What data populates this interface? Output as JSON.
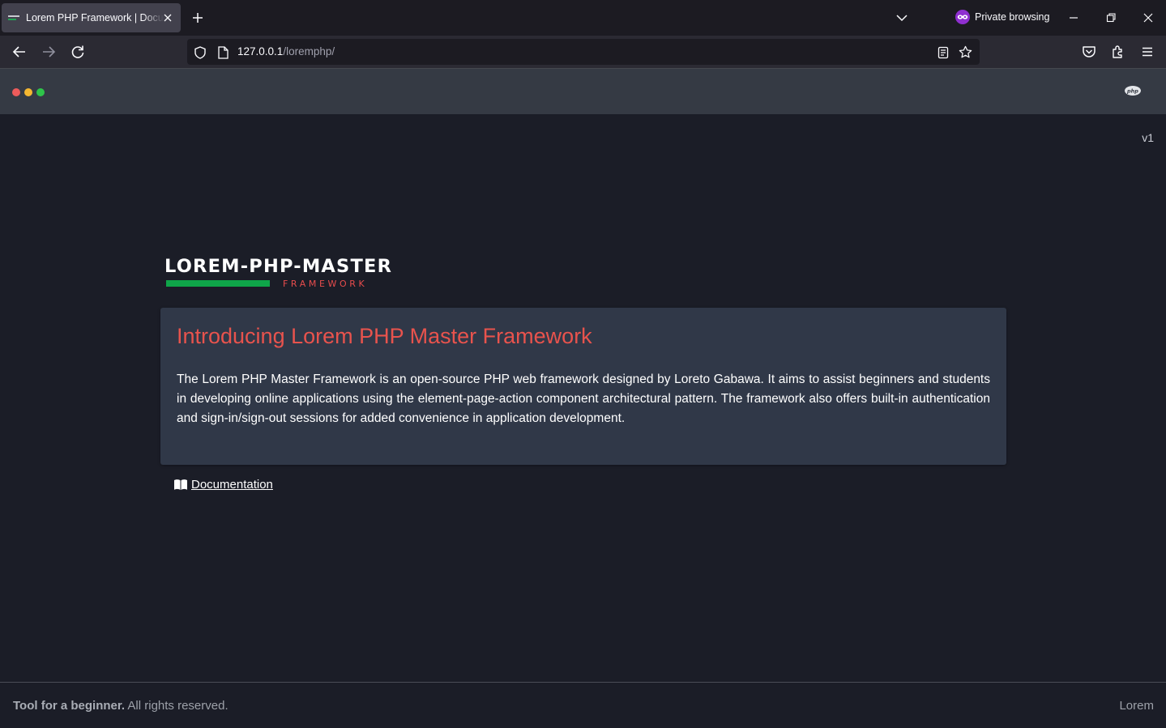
{
  "browser": {
    "tab": {
      "title": "Lorem PHP Framework | Documentation",
      "favicon": "lorem-php-favicon",
      "close_icon": "close-icon"
    },
    "new_tab_icon": "plus-icon",
    "list_tabs_icon": "chevron-down-icon",
    "private_label": "Private browsing",
    "private_icon": "private-mask-icon",
    "window_controls": [
      "minimize-icon",
      "restore-icon",
      "close-icon"
    ],
    "nav": {
      "back_icon": "back-arrow-icon",
      "forward_icon": "forward-arrow-icon",
      "reload_icon": "reload-icon"
    },
    "url": {
      "host": "127.0.0.1",
      "path": "/loremphp/"
    },
    "toolbar_icons": [
      "reader-view-icon",
      "bookmark-star-icon",
      "pocket-icon",
      "extensions-icon",
      "menu-icon"
    ]
  },
  "colors": {
    "accent_red": "#e8534d",
    "accent_green": "#0fa549",
    "dot_red": "#ed5b5b",
    "dot_yellow": "#f5b731",
    "dot_green": "#2ec44a",
    "card_bg": "#303848",
    "page_bg": "#1b1d27"
  },
  "header": {
    "dots": [
      "red",
      "yellow",
      "green"
    ],
    "logo_icon": "php-logo-icon"
  },
  "version": "v1",
  "logo": {
    "title": "LOREM-PHP-MASTER",
    "subtitle": "FRAMEWORK"
  },
  "intro": {
    "title": "Introducing Lorem PHP Master Framework",
    "body": "The Lorem PHP Master Framework is an open-source PHP web framework designed by Loreto Gabawa. It aims to assist beginners and students in developing online applications using the element-page-action component architectural pattern. The framework also offers built-in authentication and sign-in/sign-out sessions for added convenience in application development."
  },
  "documentation_link": {
    "label": "Documentation",
    "icon": "book-icon"
  },
  "footer": {
    "strong": "Tool for a beginner.",
    "rest": " All rights reserved.",
    "right": "Lorem"
  }
}
